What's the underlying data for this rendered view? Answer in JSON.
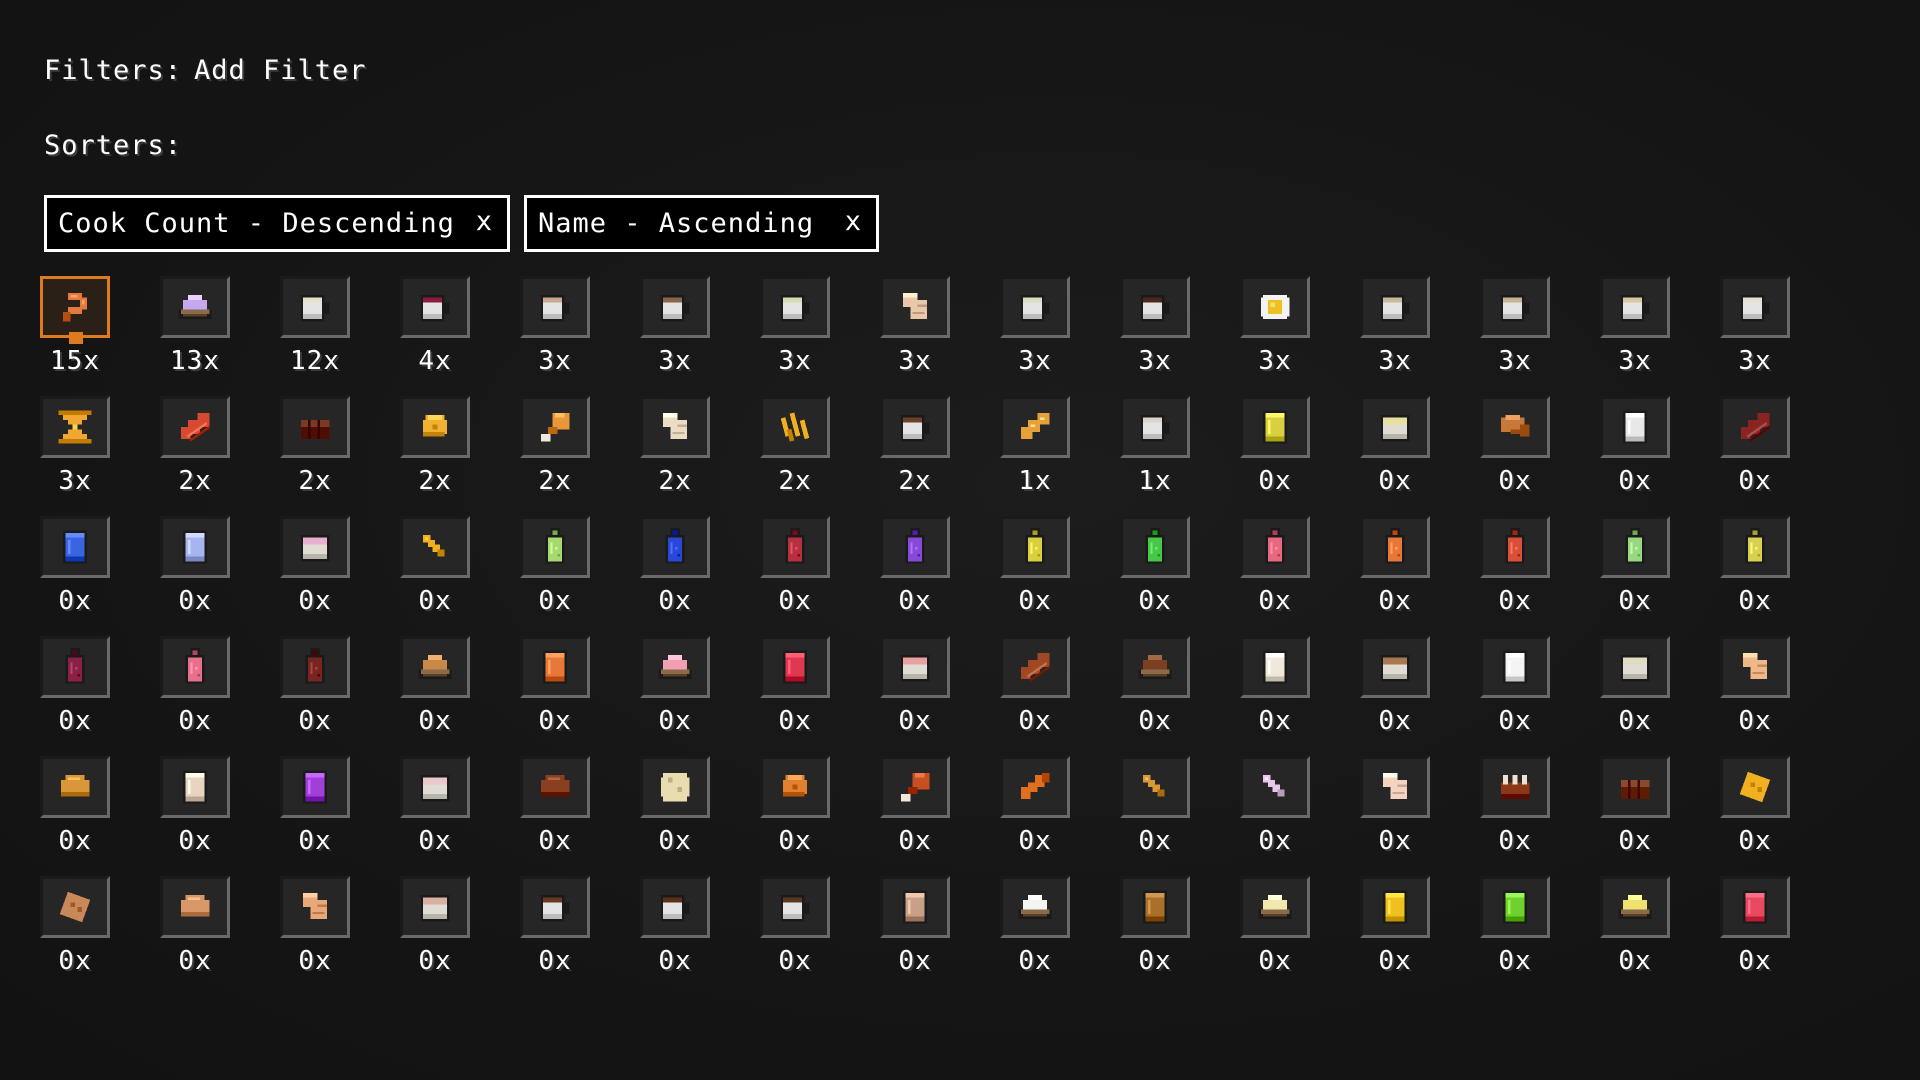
{
  "filters": {
    "label": "Filters:",
    "add_filter": "Add Filter"
  },
  "sorters": {
    "label": "Sorters:",
    "items": [
      {
        "label": "Cook Count - Descending",
        "close": "x"
      },
      {
        "label": "Name - Ascending",
        "close": "x"
      }
    ]
  },
  "colors": {
    "selected": "#e07a1e",
    "text": "#ffffff",
    "background": "#141414"
  },
  "recipes": [
    [
      {
        "icon": "shrimp-icon",
        "count": "15x",
        "type": "shrimp",
        "color": "#e07a3e",
        "selected": true
      },
      {
        "icon": "lavender-dessert-bowl-icon",
        "count": "13x",
        "type": "bowl",
        "color": "#c6a8f0"
      },
      {
        "icon": "cream-mug-icon",
        "count": "12x",
        "type": "mug",
        "color": "#e8e0c8"
      },
      {
        "icon": "berry-mug-icon",
        "count": "4x",
        "type": "mug",
        "color": "#8a1c3a"
      },
      {
        "icon": "cocoa-milk-mug-icon",
        "count": "3x",
        "type": "mug",
        "color": "#c8a890"
      },
      {
        "icon": "latte-mug-icon",
        "count": "3x",
        "type": "mug",
        "color": "#8a6548"
      },
      {
        "icon": "matcha-mug-icon",
        "count": "3x",
        "type": "mug",
        "color": "#d8dcb4"
      },
      {
        "icon": "wrap-icon",
        "count": "3x",
        "type": "wrap",
        "color": "#e8c8a8"
      },
      {
        "icon": "green-milk-mug-icon",
        "count": "3x",
        "type": "mug",
        "color": "#dcdcc0"
      },
      {
        "icon": "espresso-mug-icon",
        "count": "3x",
        "type": "mug",
        "color": "#4a2818"
      },
      {
        "icon": "fried-egg-icon",
        "count": "3x",
        "type": "egg",
        "color": "#f0c020"
      },
      {
        "icon": "chai-mug-icon",
        "count": "3x",
        "type": "mug",
        "color": "#c8b89c"
      },
      {
        "icon": "tea-mug-icon",
        "count": "3x",
        "type": "mug",
        "color": "#c8b494"
      },
      {
        "icon": "honey-milk-mug-icon",
        "count": "3x",
        "type": "mug",
        "color": "#d8c8a0"
      },
      {
        "icon": "milk-mug-icon",
        "count": "3x",
        "type": "mug",
        "color": "#e4e0d4"
      }
    ],
    [
      {
        "icon": "hourglass-cheese-icon",
        "count": "3x",
        "type": "hourglass",
        "color": "#f0a830"
      },
      {
        "icon": "bacon-icon",
        "count": "2x",
        "type": "bacon",
        "color": "#d84a30"
      },
      {
        "icon": "brownie-icon",
        "count": "2x",
        "type": "brownie",
        "color": "#7a3a24"
      },
      {
        "icon": "cheese-wedge-icon",
        "count": "2x",
        "type": "wedge",
        "color": "#f0b030"
      },
      {
        "icon": "chicken-leg-icon",
        "count": "2x",
        "type": "leg",
        "color": "#e89838"
      },
      {
        "icon": "dough-icon",
        "count": "2x",
        "type": "wrap",
        "color": "#ecdcc4"
      },
      {
        "icon": "fries-icon",
        "count": "2x",
        "type": "fries",
        "color": "#f0b020"
      },
      {
        "icon": "hot-chocolate-mug-icon",
        "count": "2x",
        "type": "mug",
        "color": "#6a4028"
      },
      {
        "icon": "baguette-icon",
        "count": "1x",
        "type": "baguette",
        "color": "#e8a038"
      },
      {
        "icon": "white-mug-icon",
        "count": "1x",
        "type": "mug",
        "color": "#dcd4cc"
      },
      {
        "icon": "lemonade-glass-icon",
        "count": "0x",
        "type": "glass",
        "color": "#d8d040"
      },
      {
        "icon": "yogurt-cup-icon",
        "count": "0x",
        "type": "cup",
        "color": "#e8e0a0"
      },
      {
        "icon": "croissant-icon",
        "count": "0x",
        "type": "croissant",
        "color": "#c87838"
      },
      {
        "icon": "milk-glass-icon",
        "count": "0x",
        "type": "glass",
        "color": "#e8e8e8"
      },
      {
        "icon": "jerky-icon",
        "count": "0x",
        "type": "bacon",
        "color": "#8a2420"
      }
    ],
    [
      {
        "icon": "blue-drink-glass-icon",
        "count": "0x",
        "type": "glass",
        "color": "#3a64e0"
      },
      {
        "icon": "periwinkle-drink-glass-icon",
        "count": "0x",
        "type": "glass",
        "color": "#a8b4f0"
      },
      {
        "icon": "pink-cup-icon",
        "count": "0x",
        "type": "cup",
        "color": "#e8b0d0"
      },
      {
        "icon": "pretzel-stick-icon",
        "count": "0x",
        "type": "stick",
        "color": "#f0b020"
      },
      {
        "icon": "lime-soda-bottle-icon",
        "count": "0x",
        "type": "bottle",
        "color": "#a8d870"
      },
      {
        "icon": "blueberry-soda-bottle-icon",
        "count": "0x",
        "type": "bottle",
        "color": "#2a48d8"
      },
      {
        "icon": "cherry-soda-bottle-icon",
        "count": "0x",
        "type": "bottle",
        "color": "#b83040"
      },
      {
        "icon": "grape-soda-bottle-icon",
        "count": "0x",
        "type": "bottle",
        "color": "#8848d8"
      },
      {
        "icon": "lemon-soda-bottle-icon",
        "count": "0x",
        "type": "bottle",
        "color": "#d8d040"
      },
      {
        "icon": "apple-soda-bottle-icon",
        "count": "0x",
        "type": "bottle",
        "color": "#48c848"
      },
      {
        "icon": "strawberry-soda-bottle-icon",
        "count": "0x",
        "type": "bottle",
        "color": "#e86880"
      },
      {
        "icon": "orange-soda-bottle-icon",
        "count": "0x",
        "type": "bottle",
        "color": "#e87838"
      },
      {
        "icon": "blood-orange-soda-bottle-icon",
        "count": "0x",
        "type": "bottle",
        "color": "#d85038"
      },
      {
        "icon": "kiwi-soda-bottle-icon",
        "count": "0x",
        "type": "bottle",
        "color": "#98d880"
      },
      {
        "icon": "pineapple-soda-bottle-icon",
        "count": "0x",
        "type": "bottle",
        "color": "#d8d050"
      }
    ],
    [
      {
        "icon": "plum-soda-bottle-icon",
        "count": "0x",
        "type": "bottle",
        "color": "#8a2048"
      },
      {
        "icon": "raspberry-soda-bottle-icon",
        "count": "0x",
        "type": "bottle",
        "color": "#e8708c"
      },
      {
        "icon": "cola-bottle-icon",
        "count": "0x",
        "type": "bottle",
        "color": "#7a2420"
      },
      {
        "icon": "cookie-bowl-icon",
        "count": "0x",
        "type": "bowl",
        "color": "#c88848"
      },
      {
        "icon": "orange-juice-glass-icon",
        "count": "0x",
        "type": "glass",
        "color": "#e87838"
      },
      {
        "icon": "strawberry-ice-cream-bowl-icon",
        "count": "0x",
        "type": "bowl",
        "color": "#f0a0b0"
      },
      {
        "icon": "red-juice-glass-icon",
        "count": "0x",
        "type": "glass",
        "color": "#e03850"
      },
      {
        "icon": "strawberry-milk-cup-icon",
        "count": "0x",
        "type": "cup",
        "color": "#e8a0a0"
      },
      {
        "icon": "steak-icon",
        "count": "0x",
        "type": "bacon",
        "color": "#a04824"
      },
      {
        "icon": "chocolate-chip-bowl-icon",
        "count": "0x",
        "type": "bowl",
        "color": "#7a4020"
      },
      {
        "icon": "vanilla-milkshake-glass-icon",
        "count": "0x",
        "type": "glass",
        "color": "#f0e8d8"
      },
      {
        "icon": "coffee-cup-icon",
        "count": "0x",
        "type": "cup",
        "color": "#a87850"
      },
      {
        "icon": "frosty-milk-glass-icon",
        "count": "0x",
        "type": "glass",
        "color": "#f4f4f4"
      },
      {
        "icon": "oat-milk-cup-icon",
        "count": "0x",
        "type": "cup",
        "color": "#e0dcc0"
      },
      {
        "icon": "tortilla-icon",
        "count": "0x",
        "type": "wrap",
        "color": "#f0b888"
      }
    ],
    [
      {
        "icon": "bread-loaf-icon",
        "count": "0x",
        "type": "loaf",
        "color": "#d89838"
      },
      {
        "icon": "iced-coffee-glass-icon",
        "count": "0x",
        "type": "glass",
        "color": "#e8d4c0"
      },
      {
        "icon": "grape-juice-glass-icon",
        "count": "0x",
        "type": "glass",
        "color": "#a040d8"
      },
      {
        "icon": "rose-milk-cup-icon",
        "count": "0x",
        "type": "cup",
        "color": "#e8c8c8"
      },
      {
        "icon": "meatball-icon",
        "count": "0x",
        "type": "loaf",
        "color": "#8a4020"
      },
      {
        "icon": "flatbread-icon",
        "count": "0x",
        "type": "disc",
        "color": "#e8dcb0"
      },
      {
        "icon": "roast-icon",
        "count": "0x",
        "type": "wedge",
        "color": "#e08030"
      },
      {
        "icon": "drumstick-icon",
        "count": "0x",
        "type": "leg",
        "color": "#c85020"
      },
      {
        "icon": "chicken-wing-icon",
        "count": "0x",
        "type": "wing",
        "color": "#e07020"
      },
      {
        "icon": "breadstick-icon",
        "count": "0x",
        "type": "stick",
        "color": "#d89838"
      },
      {
        "icon": "candy-stick-icon",
        "count": "0x",
        "type": "stick",
        "color": "#e8c8e8"
      },
      {
        "icon": "pita-icon",
        "count": "0x",
        "type": "wrap",
        "color": "#f4d4c0"
      },
      {
        "icon": "ribs-icon",
        "count": "0x",
        "type": "ribs",
        "color": "#8a3818"
      },
      {
        "icon": "chocolate-bar-icon",
        "count": "0x",
        "type": "brownie",
        "color": "#8a4a30"
      },
      {
        "icon": "cheese-block-icon",
        "count": "0x",
        "type": "block",
        "color": "#f0b020"
      }
    ],
    [
      {
        "icon": "toast-icon",
        "count": "0x",
        "type": "block",
        "color": "#c88858"
      },
      {
        "icon": "bread-roll-icon",
        "count": "0x",
        "type": "loaf",
        "color": "#d89868"
      },
      {
        "icon": "ham-slice-icon",
        "count": "0x",
        "type": "wrap",
        "color": "#e8a878"
      },
      {
        "icon": "peach-milk-cup-icon",
        "count": "0x",
        "type": "cup",
        "color": "#d8b0a0"
      },
      {
        "icon": "mocha-mug-icon",
        "count": "0x",
        "type": "mug",
        "color": "#6a3820"
      },
      {
        "icon": "dark-coffee-mug-icon",
        "count": "0x",
        "type": "mug",
        "color": "#5a3018"
      },
      {
        "icon": "americano-mug-icon",
        "count": "0x",
        "type": "mug",
        "color": "#5a3820"
      },
      {
        "icon": "caramel-glass-icon",
        "count": "0x",
        "type": "glass",
        "color": "#c8a088"
      },
      {
        "icon": "rice-bowl-icon",
        "count": "0x",
        "type": "bowl",
        "color": "#f4f4f0"
      },
      {
        "icon": "tea-glass-icon",
        "count": "0x",
        "type": "glass",
        "color": "#a87028"
      },
      {
        "icon": "porridge-bowl-icon",
        "count": "0x",
        "type": "bowl",
        "color": "#f0e8b0"
      },
      {
        "icon": "honey-glass-icon",
        "count": "0x",
        "type": "glass",
        "color": "#f0c020"
      },
      {
        "icon": "green-juice-glass-icon",
        "count": "0x",
        "type": "glass",
        "color": "#70d030"
      },
      {
        "icon": "custard-bowl-icon",
        "count": "0x",
        "type": "bowl",
        "color": "#f0e070"
      },
      {
        "icon": "punch-glass-icon",
        "count": "0x",
        "type": "glass",
        "color": "#e84860"
      }
    ]
  ]
}
